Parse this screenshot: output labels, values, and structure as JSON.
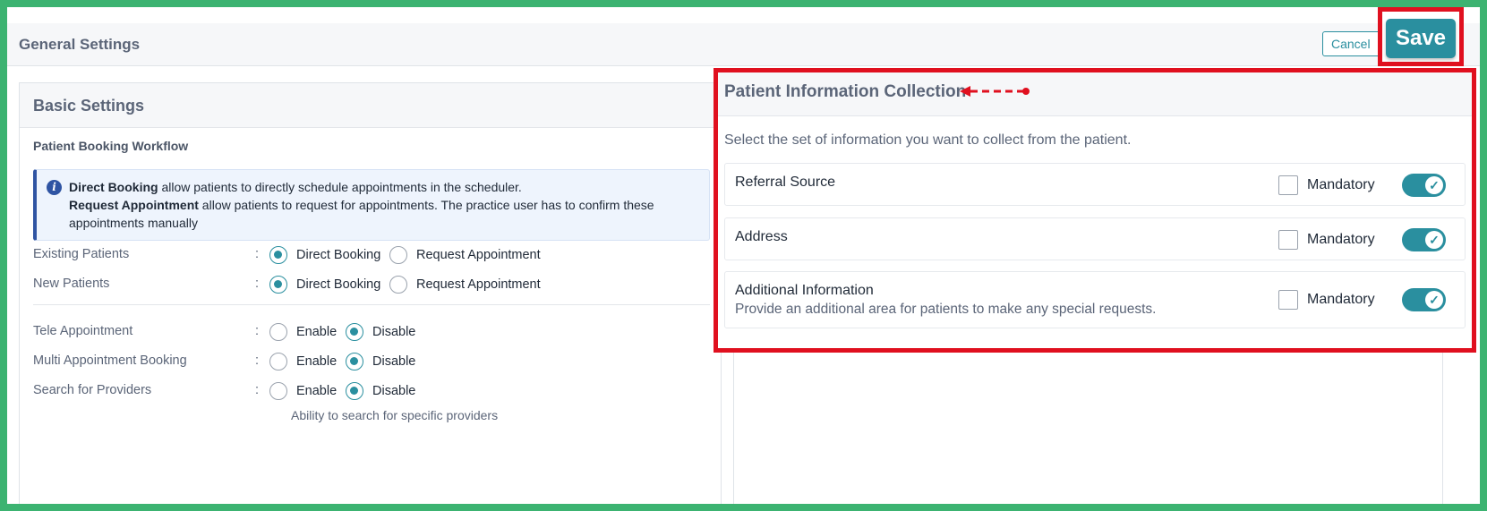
{
  "header": {
    "title": "General Settings",
    "cancel_label": "Cancel",
    "save_label": "Save"
  },
  "basic_settings": {
    "title": "Basic Settings",
    "workflow_heading": "Patient Booking Workflow",
    "info": {
      "direct_booking_term": "Direct Booking",
      "direct_booking_text": " allow patients to directly schedule appointments in the scheduler.",
      "request_term": "Request Appointment",
      "request_text": " allow patients to request for appointments. The practice user has to confirm these appointments manually"
    },
    "rows": [
      {
        "label": "Existing Patients",
        "options": [
          "Direct Booking",
          "Request Appointment"
        ],
        "selected": "Direct Booking"
      },
      {
        "label": "New Patients",
        "options": [
          "Direct Booking",
          "Request Appointment"
        ],
        "selected": "Direct Booking"
      },
      {
        "label": "Tele Appointment",
        "options": [
          "Enable",
          "Disable"
        ],
        "selected": "Disable"
      },
      {
        "label": "Multi Appointment Booking",
        "options": [
          "Enable",
          "Disable"
        ],
        "selected": "Disable"
      },
      {
        "label": "Search for Providers",
        "options": [
          "Enable",
          "Disable"
        ],
        "selected": "Disable"
      }
    ],
    "colon": ":",
    "search_helper": "Ability to search for specific providers"
  },
  "patient_info": {
    "title": "Patient Information Collection",
    "description": "Select the set of information you want to collect from the patient.",
    "mandatory_label": "Mandatory",
    "items": [
      {
        "name": "Referral Source",
        "subtext": "",
        "mandatory": false,
        "enabled": true
      },
      {
        "name": "Address",
        "subtext": "",
        "mandatory": false,
        "enabled": true
      },
      {
        "name": "Additional Information",
        "subtext": "Provide an additional area for patients to make any special requests.",
        "mandatory": false,
        "enabled": true
      }
    ]
  },
  "colors": {
    "accent": "#2a8f9f",
    "highlight": "#e0101f",
    "info_border": "#2f54a3",
    "frame": "#3cb371"
  },
  "icons": {
    "info": "info-icon",
    "check": "check-icon",
    "arrow": "dashed-arrow-icon"
  }
}
